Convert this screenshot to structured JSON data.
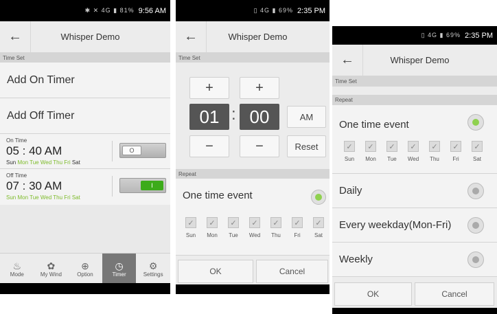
{
  "screen1": {
    "status_time": "9:56 AM",
    "status_icons": "✱ ✕ 4G ▮ 81%",
    "title": "Whisper Demo",
    "section_time_set": "Time Set",
    "add_on_timer": "Add On Timer",
    "add_off_timer": "Add Off Timer",
    "on_timer": {
      "label": "On Time",
      "time": "05 : 40 AM",
      "days": [
        {
          "d": "Sun",
          "on": false
        },
        {
          "d": "Mon",
          "on": true
        },
        {
          "d": "Tue",
          "on": true
        },
        {
          "d": "Wed",
          "on": true
        },
        {
          "d": "Thu",
          "on": true
        },
        {
          "d": "Fri",
          "on": true
        },
        {
          "d": "Sat",
          "on": false
        }
      ],
      "toggle": "O",
      "enabled": false
    },
    "off_timer": {
      "label": "Off Time",
      "time": "07 : 30 AM",
      "days": [
        {
          "d": "Sun",
          "on": true
        },
        {
          "d": "Mon",
          "on": true
        },
        {
          "d": "Tue",
          "on": true
        },
        {
          "d": "Wed",
          "on": true
        },
        {
          "d": "Thu",
          "on": true
        },
        {
          "d": "Fri",
          "on": true
        },
        {
          "d": "Sat",
          "on": true
        }
      ],
      "toggle": "I",
      "enabled": true
    },
    "nav": [
      {
        "label": "Mode",
        "icon": "mode-icon",
        "glyph": "♨"
      },
      {
        "label": "My Wind",
        "icon": "fan-icon",
        "glyph": "✿"
      },
      {
        "label": "Option",
        "icon": "plus-circle-icon",
        "glyph": "⊕"
      },
      {
        "label": "Timer",
        "icon": "clock-icon",
        "glyph": "◷"
      },
      {
        "label": "Settings",
        "icon": "gear-icon",
        "glyph": "⚙"
      }
    ],
    "active_nav": "Timer"
  },
  "screen2": {
    "status_time": "2:35 PM",
    "status_icons": "▯ 4G ▮ 69%",
    "title": "Whisper Demo",
    "section_time_set": "Time Set",
    "plus": "+",
    "minus": "−",
    "hour": "01",
    "minute": "00",
    "colon": ":",
    "ampm": "AM",
    "reset": "Reset",
    "section_repeat": "Repeat",
    "one_time": "One time event",
    "days": [
      "Sun",
      "Mon",
      "Tue",
      "Wed",
      "Thu",
      "Fri",
      "Sat"
    ],
    "check": "✓",
    "ok": "OK",
    "cancel": "Cancel"
  },
  "screen3": {
    "status_time": "2:35 PM",
    "status_icons": "▯ 4G ▮ 69%",
    "title": "Whisper Demo",
    "section_time_set": "Time Set",
    "section_repeat": "Repeat",
    "options": [
      "One time event",
      "Daily",
      "Every weekday(Mon-Fri)",
      "Weekly"
    ],
    "selected": "One time event",
    "days": [
      "Sun",
      "Mon",
      "Tue",
      "Wed",
      "Thu",
      "Fri",
      "Sat"
    ],
    "check": "✓",
    "ok": "OK",
    "cancel": "Cancel"
  },
  "colors": {
    "accent_green": "#8fd14f",
    "toggle_green": "#3cab1a",
    "day_green": "#7dbb2a"
  }
}
